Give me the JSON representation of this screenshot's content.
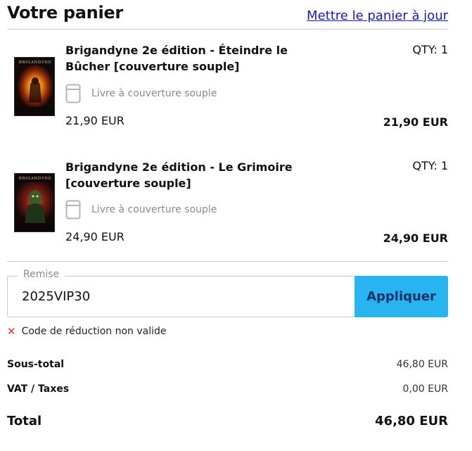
{
  "header": {
    "title": "Votre panier",
    "update_link": "Mettre le panier à jour"
  },
  "items": [
    {
      "cover_label": "BRIGANDYNE",
      "title": "Brigandyne 2e édition - Éteindre le Bûcher [couverture souple]",
      "qty": "QTY: 1",
      "format": "Livre à couverture souple",
      "format_icon": "book-icon",
      "unit_price": "21,90 EUR",
      "line_total": "21,90 EUR"
    },
    {
      "cover_label": "BRIGANDYNE",
      "title": "Brigandyne 2e édition - Le Grimoire [couverture souple]",
      "qty": "QTY: 1",
      "format": "Livre à couverture souple",
      "format_icon": "book-icon",
      "unit_price": "24,90 EUR",
      "line_total": "24,90 EUR"
    }
  ],
  "discount": {
    "legend": "Remise",
    "value": "2025VIP30",
    "apply_label": "Appliquer",
    "error": "Code de réduction non valide",
    "error_icon": "close-icon"
  },
  "summary": {
    "subtotal_label": "Sous-total",
    "subtotal_value": "46,80 EUR",
    "tax_label": "VAT / Taxes",
    "tax_value": "0,00 EUR",
    "total_label": "Total",
    "total_value": "46,80 EUR"
  },
  "colors": {
    "accent": "#27b4ef",
    "link": "#1a1aa6",
    "error": "#e03030"
  }
}
